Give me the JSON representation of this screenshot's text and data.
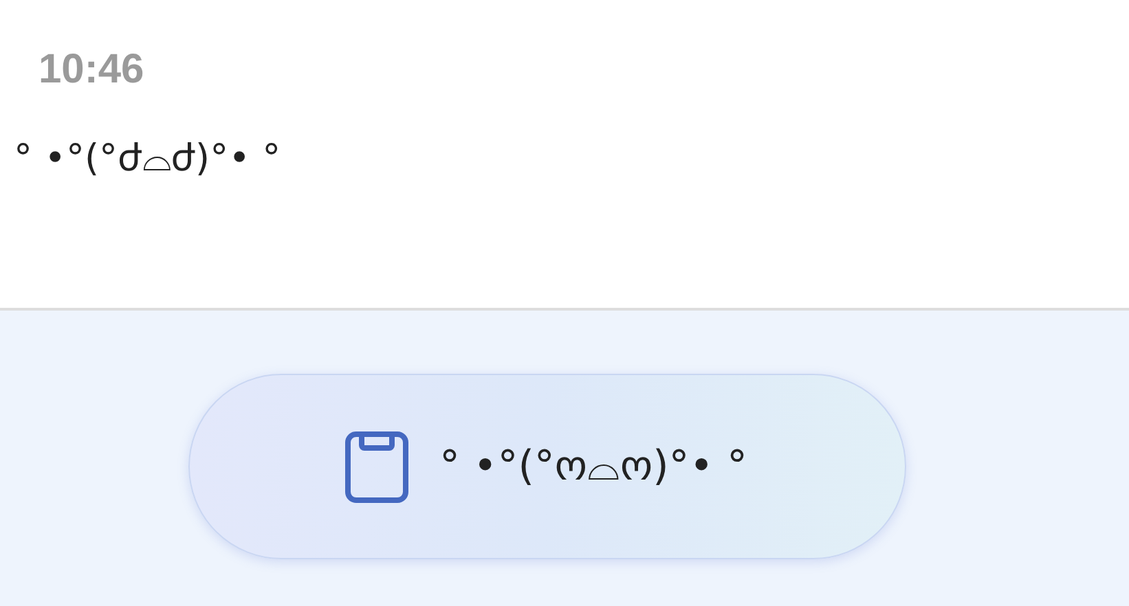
{
  "message": {
    "time": "10:46",
    "text": "° •°(°ժ⌓ժ)°• °"
  },
  "suggestion": {
    "label": "° •°(°ო⌓ო)°• °"
  }
}
